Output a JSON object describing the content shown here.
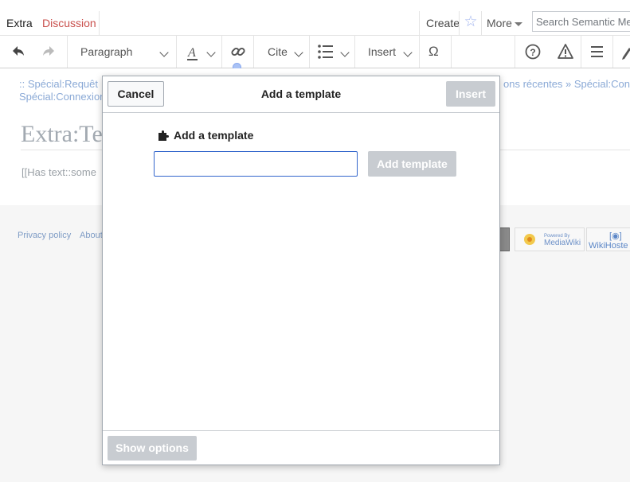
{
  "tabs": {
    "extra": "Extra",
    "discussion": "Discussion",
    "create": "Create",
    "more": "More"
  },
  "search": {
    "placeholder": "Search Semantic Me"
  },
  "toolbar": {
    "paragraph": "Paragraph",
    "cite": "Cite",
    "insert": "Insert",
    "special_char": "Ω"
  },
  "page": {
    "breadcrumb_line1": ":: Spécial:Requêt",
    "breadcrumb_line1_right": "ons récentes » Spécial:Conn",
    "breadcrumb_line2": "Spécial:Connexion",
    "title": "Extra:Te",
    "content": "[[Has text::some"
  },
  "footer": {
    "privacy": "Privacy policy",
    "about": "About",
    "mediawiki_badge": "Powered By MediaWiki",
    "wikihoster_badge": "WikiHoste"
  },
  "dialog": {
    "cancel": "Cancel",
    "title": "Add a template",
    "insert": "Insert",
    "section_label": "Add a template",
    "input_value": "",
    "add_template": "Add template",
    "show_options": "Show options"
  }
}
